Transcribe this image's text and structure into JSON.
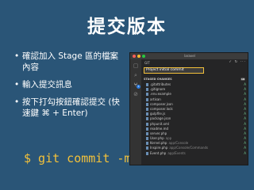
{
  "slide": {
    "title": "提交版本",
    "bullets": [
      "確認加入 Stage 區的檔案內容",
      "輸入提交訊息",
      "按下打勾按鈕確認提交 (快速鍵 ⌘ + Enter)"
    ],
    "command": "$ git commit -m"
  },
  "editor": {
    "window_title": "laravel",
    "scm_header": "GIT",
    "scm_actions": "✓ ↻ ···",
    "commit_message": "Project initial commit",
    "changes_header": "STAGED CHANGES",
    "changes_count": "19",
    "activity_badge": "1",
    "files": [
      {
        "name": ".gitattributes",
        "dir": "",
        "status": "A"
      },
      {
        "name": ".gitignore",
        "dir": "",
        "status": "A"
      },
      {
        "name": ".env.example",
        "dir": "",
        "status": "A"
      },
      {
        "name": "artisan",
        "dir": "",
        "status": "A"
      },
      {
        "name": "composer.json",
        "dir": "",
        "status": "A"
      },
      {
        "name": "composer.lock",
        "dir": "",
        "status": "A"
      },
      {
        "name": "gulpfile.js",
        "dir": "",
        "status": "A"
      },
      {
        "name": "package.json",
        "dir": "",
        "status": "A"
      },
      {
        "name": "phpunit.xml",
        "dir": "",
        "status": "A"
      },
      {
        "name": "readme.md",
        "dir": "",
        "status": "A"
      },
      {
        "name": "server.php",
        "dir": "",
        "status": "A"
      },
      {
        "name": "User.php",
        "dir": "app",
        "status": "A"
      },
      {
        "name": "Kernel.php",
        "dir": "app/Console",
        "status": "A"
      },
      {
        "name": "Inspire.php",
        "dir": "app/Console/Commands",
        "status": "A"
      },
      {
        "name": "Event.php",
        "dir": "app/Events",
        "status": "A"
      }
    ]
  },
  "colors": {
    "background": "#2a5577",
    "command": "#f3c13a",
    "commit_box_border": "#f3c13a"
  }
}
